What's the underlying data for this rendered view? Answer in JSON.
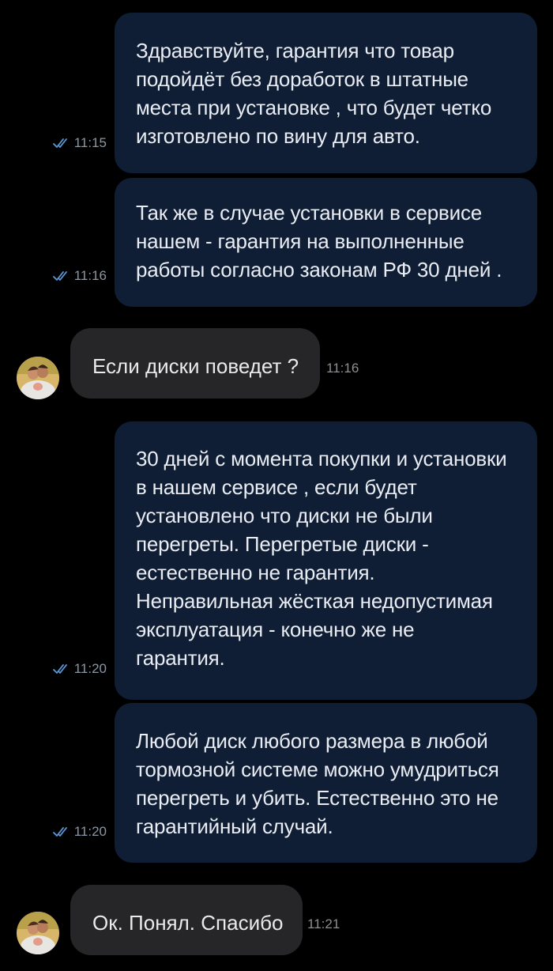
{
  "colors": {
    "background": "#000000",
    "outgoing_bubble": "#0f1e34",
    "incoming_bubble": "#262629",
    "read_check": "#5b9bdc",
    "timestamp": "#8b96a3"
  },
  "messages": [
    {
      "direction": "outgoing",
      "text": "Здравствуйте, гарантия что товар\nподойдёт без доработок в штатные\nместа при установке , что будет четко\nизготовлено по вину для авто.",
      "time": "11:15",
      "status": "read"
    },
    {
      "direction": "outgoing",
      "text": "Так же в случае установки в сервисе\nнашем - гарантия на выполненные\nработы согласно законам РФ 30 дней .",
      "time": "11:16",
      "status": "read"
    },
    {
      "direction": "incoming",
      "text": "Если диски поведет ?",
      "time": "11:16",
      "avatar": "user-avatar-photo"
    },
    {
      "direction": "outgoing",
      "text": "30 дней с момента покупки и установки\nв нашем сервисе , если будет\nустановлено что диски не были\nперегреты. Перегретые диски -\nестественно не гарантия.\nНеправильная жёсткая недопустимая\nэксплуатация - конечно же не\nгарантия.",
      "time": "11:20",
      "status": "read"
    },
    {
      "direction": "outgoing",
      "text": "Любой диск любого размера в любой\nтормозной системе можно умудриться\nперегреть и убить. Естественно это не\nгарантийный случай.",
      "time": "11:20",
      "status": "read"
    },
    {
      "direction": "incoming",
      "text": "Ок. Понял. Спасибо",
      "time": "11:21",
      "avatar": "user-avatar-photo"
    }
  ]
}
